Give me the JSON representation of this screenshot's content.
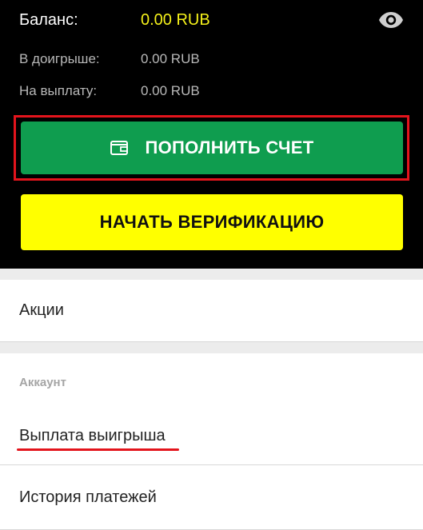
{
  "balance": {
    "label": "Баланс:",
    "value": "0.00 RUB",
    "in_play_label": "В доигрыше:",
    "in_play_value": "0.00 RUB",
    "payout_label": "На выплату:",
    "payout_value": "0.00 RUB",
    "toggle_icon": "eye-icon"
  },
  "buttons": {
    "deposit_label": "ПОПОЛНИТЬ СЧЕТ",
    "deposit_icon": "wallet-icon",
    "verify_label": "НАЧАТЬ ВЕРИФИКАЦИЮ"
  },
  "menu": {
    "promotions": "Акции",
    "account_section": "Аккаунт",
    "payout": "Выплата выигрыша",
    "payment_history": "История платежей"
  },
  "colors": {
    "balance_value": "#f5f11a",
    "deposit_button": "#0f9d4f",
    "verify_button": "#ffff00",
    "highlight": "#e3141c"
  }
}
